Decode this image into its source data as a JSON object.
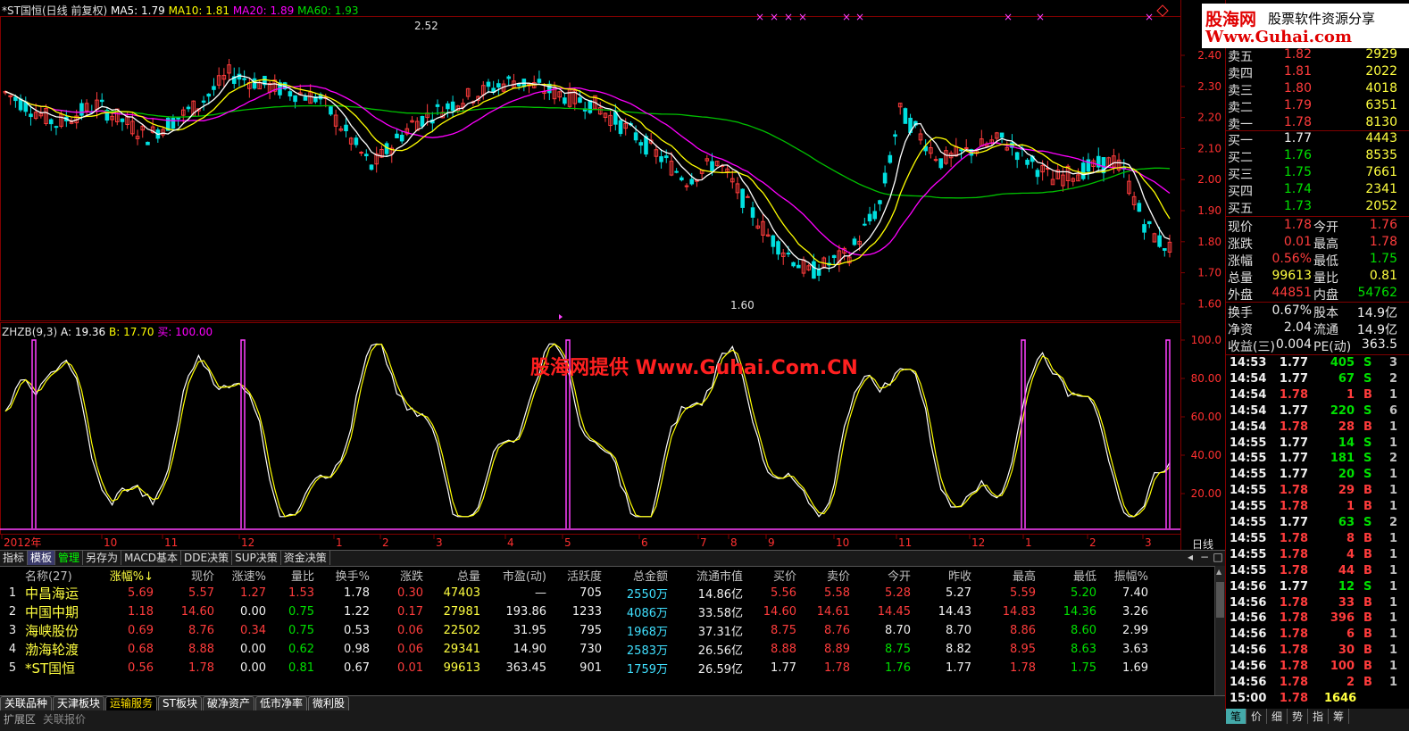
{
  "header": {
    "title": "*ST国恒(日线 前复权)",
    "ma5": "MA5: 1.79",
    "ma10": "MA10: 1.81",
    "ma20": "MA20: 1.89",
    "ma60": "MA60: 1.93",
    "high_marker": "2.52",
    "low_marker": "1.60"
  },
  "price_axis": [
    "2.40",
    "2.30",
    "2.20",
    "2.10",
    "2.00",
    "1.90",
    "1.80",
    "1.70",
    "1.60"
  ],
  "indicator": {
    "title": "ZHZB(9,3)",
    "a": "A: 19.36",
    "b": "B: 17.70",
    "buy": "买: 100.00",
    "axis": [
      "100.0",
      "80.00",
      "60.00",
      "40.00",
      "20.00"
    ]
  },
  "watermark": "股海网提供 Www.Guhai.Com.CN",
  "date_axis": [
    "2012年",
    "10",
    "11",
    "12",
    "1",
    "2",
    "3",
    "4",
    "5",
    "6",
    "7",
    "8",
    "9",
    "10",
    "11",
    "12",
    "1",
    "2",
    "3"
  ],
  "period_label": "日线",
  "tabs": [
    "指标",
    "模板",
    "管理",
    "另存为",
    "MACD基本",
    "DDE决策",
    "SUP决策",
    "资金决策"
  ],
  "table": {
    "headers": [
      "",
      "名称(27)",
      "涨幅%↓",
      "现价",
      "涨速%",
      "量比",
      "换手%",
      "涨跌",
      "总量",
      "市盈(动)",
      "活跃度",
      "总金额",
      "流通市值",
      "买价",
      "卖价",
      "今开",
      "昨收",
      "最高",
      "最低",
      "振幅%"
    ],
    "rows": [
      [
        "1",
        "中昌海运",
        "5.69",
        "5.57",
        "1.27",
        "1.53",
        "1.78",
        "0.30",
        "47403",
        "—",
        "705",
        "2550万",
        "14.86亿",
        "5.56",
        "5.58",
        "5.28",
        "5.27",
        "5.59",
        "5.20",
        "7.40"
      ],
      [
        "2",
        "中国中期",
        "1.18",
        "14.60",
        "0.00",
        "0.75",
        "1.22",
        "0.17",
        "27981",
        "193.86",
        "1233",
        "4086万",
        "33.58亿",
        "14.60",
        "14.61",
        "14.45",
        "14.43",
        "14.83",
        "14.36",
        "3.26"
      ],
      [
        "3",
        "海峡股份",
        "0.69",
        "8.76",
        "0.34",
        "0.75",
        "0.53",
        "0.06",
        "22502",
        "31.95",
        "795",
        "1968万",
        "37.31亿",
        "8.75",
        "8.76",
        "8.70",
        "8.70",
        "8.86",
        "8.60",
        "2.99"
      ],
      [
        "4",
        "渤海轮渡",
        "0.68",
        "8.88",
        "0.00",
        "0.62",
        "0.98",
        "0.06",
        "29341",
        "14.90",
        "730",
        "2583万",
        "26.56亿",
        "8.88",
        "8.89",
        "8.75",
        "8.82",
        "8.95",
        "8.63",
        "3.63"
      ],
      [
        "5",
        "*ST国恒",
        "0.56",
        "1.78",
        "0.00",
        "0.81",
        "0.67",
        "0.01",
        "99613",
        "363.45",
        "901",
        "1759万",
        "26.59亿",
        "1.77",
        "1.78",
        "1.76",
        "1.77",
        "1.78",
        "1.75",
        "1.69"
      ]
    ]
  },
  "bottom_tabs": [
    "关联品种",
    "天津板块",
    "运输服务",
    "ST板块",
    "破净资产",
    "低市净率",
    "微利股"
  ],
  "status": [
    "扩展区",
    "关联报价"
  ],
  "logo": {
    "brand": "股海网",
    "slogan": "股票软件资源分享",
    "url": "Www.Guhai.com"
  },
  "orderbook": {
    "sell": [
      [
        "卖五",
        "1.82",
        "2929"
      ],
      [
        "卖四",
        "1.81",
        "2022"
      ],
      [
        "卖三",
        "1.80",
        "4018"
      ],
      [
        "卖二",
        "1.79",
        "6351"
      ],
      [
        "卖一",
        "1.78",
        "8130"
      ]
    ],
    "buy": [
      [
        "买一",
        "1.77",
        "4443"
      ],
      [
        "买二",
        "1.76",
        "8535"
      ],
      [
        "买三",
        "1.75",
        "7661"
      ],
      [
        "买四",
        "1.74",
        "2341"
      ],
      [
        "买五",
        "1.73",
        "2052"
      ]
    ]
  },
  "stats": [
    [
      "现价",
      "1.78",
      "今开",
      "1.76"
    ],
    [
      "涨跌",
      "0.01",
      "最高",
      "1.78"
    ],
    [
      "涨幅",
      "0.56%",
      "最低",
      "1.75"
    ],
    [
      "总量",
      "99613",
      "量比",
      "0.81"
    ],
    [
      "外盘",
      "44851",
      "内盘",
      "54762"
    ],
    [
      "换手",
      "0.67%",
      "股本",
      "14.9亿"
    ],
    [
      "净资",
      "2.04",
      "流通",
      "14.9亿"
    ],
    [
      "收益(三)",
      "0.004",
      "PE(动)",
      "363.5"
    ]
  ],
  "ticks": [
    [
      "14:53",
      "1.77",
      "405",
      "S",
      "3"
    ],
    [
      "14:54",
      "1.77",
      "67",
      "S",
      "2"
    ],
    [
      "14:54",
      "1.78",
      "1",
      "B",
      "1"
    ],
    [
      "14:54",
      "1.77",
      "220",
      "S",
      "6"
    ],
    [
      "14:54",
      "1.78",
      "28",
      "B",
      "1"
    ],
    [
      "14:55",
      "1.77",
      "14",
      "S",
      "1"
    ],
    [
      "14:55",
      "1.77",
      "181",
      "S",
      "2"
    ],
    [
      "14:55",
      "1.77",
      "20",
      "S",
      "1"
    ],
    [
      "14:55",
      "1.78",
      "29",
      "B",
      "1"
    ],
    [
      "14:55",
      "1.78",
      "1",
      "B",
      "1"
    ],
    [
      "14:55",
      "1.77",
      "63",
      "S",
      "2"
    ],
    [
      "14:55",
      "1.78",
      "8",
      "B",
      "1"
    ],
    [
      "14:55",
      "1.78",
      "4",
      "B",
      "1"
    ],
    [
      "14:55",
      "1.78",
      "44",
      "B",
      "1"
    ],
    [
      "14:56",
      "1.77",
      "12",
      "S",
      "1"
    ],
    [
      "14:56",
      "1.78",
      "33",
      "B",
      "1"
    ],
    [
      "14:56",
      "1.78",
      "396",
      "B",
      "1"
    ],
    [
      "14:56",
      "1.78",
      "6",
      "B",
      "1"
    ],
    [
      "14:56",
      "1.78",
      "30",
      "B",
      "1"
    ],
    [
      "14:56",
      "1.78",
      "100",
      "B",
      "1"
    ],
    [
      "14:56",
      "1.78",
      "2",
      "B",
      "1"
    ],
    [
      "15:00",
      "1.78",
      "1646",
      "",
      ""
    ]
  ],
  "side_bottom_tabs": [
    "笔",
    "价",
    "细",
    "势",
    "指",
    "筹"
  ],
  "colors": {
    "up": "#ff3c3c",
    "down": "#00e000",
    "ma5": "#ffffff",
    "ma10": "#ffff00",
    "ma20": "#ff00ff",
    "ma60": "#00c000",
    "frame": "#800000"
  }
}
